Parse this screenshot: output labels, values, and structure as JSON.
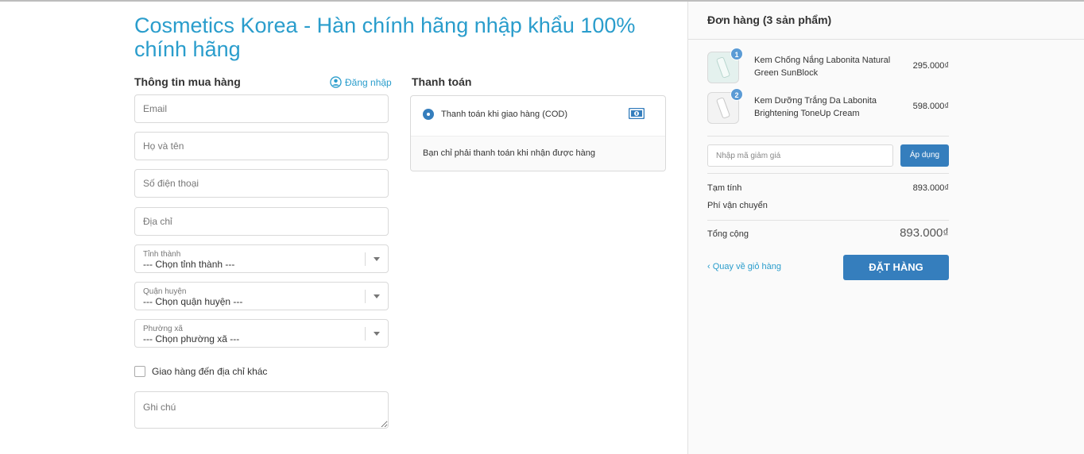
{
  "shop": {
    "title": "Cosmetics Korea - Hàn chính hãng nhập khẩu 100% chính hãng"
  },
  "buyer": {
    "heading": "Thông tin mua hàng",
    "login_label": "Đăng nhập",
    "email_placeholder": "Email",
    "name_placeholder": "Họ và tên",
    "phone_placeholder": "Số điện thoại",
    "address_placeholder": "Địa chỉ",
    "province": {
      "label": "Tỉnh thành",
      "value": "--- Chọn tỉnh thành ---"
    },
    "district": {
      "label": "Quận huyện",
      "value": "--- Chọn quận huyện ---"
    },
    "ward": {
      "label": "Phường xã",
      "value": "--- Chọn phường xã ---"
    },
    "other_address_label": "Giao hàng đến địa chỉ khác",
    "note_placeholder": "Ghi chú"
  },
  "payment": {
    "heading": "Thanh toán",
    "method_label": "Thanh toán khi giao hàng (COD)",
    "method_icon": "cash-icon",
    "description": "Bạn chỉ phải thanh toán khi nhận được hàng"
  },
  "order": {
    "heading": "Đơn hàng (3 sản phẩm)",
    "items": [
      {
        "qty": "1",
        "name": "Kem Chống Nắng Labonita Natural Green SunBlock",
        "price": "295.000₫"
      },
      {
        "qty": "2",
        "name": "Kem Dưỡng Trắng Da Labonita Brightening ToneUp Cream",
        "price": "598.000₫"
      }
    ],
    "discount_placeholder": "Nhập mã giảm giá",
    "apply_label": "Áp dụng",
    "subtotal_label": "Tạm tính",
    "subtotal_value": "893.000₫",
    "shipping_label": "Phí vận chuyển",
    "total_label": "Tổng cộng",
    "total_value": "893.000₫",
    "back_label": "Quay về giỏ hàng",
    "submit_label": "ĐẶT HÀNG"
  },
  "colors": {
    "accent": "#2a9dcc",
    "button": "#357ebd"
  }
}
